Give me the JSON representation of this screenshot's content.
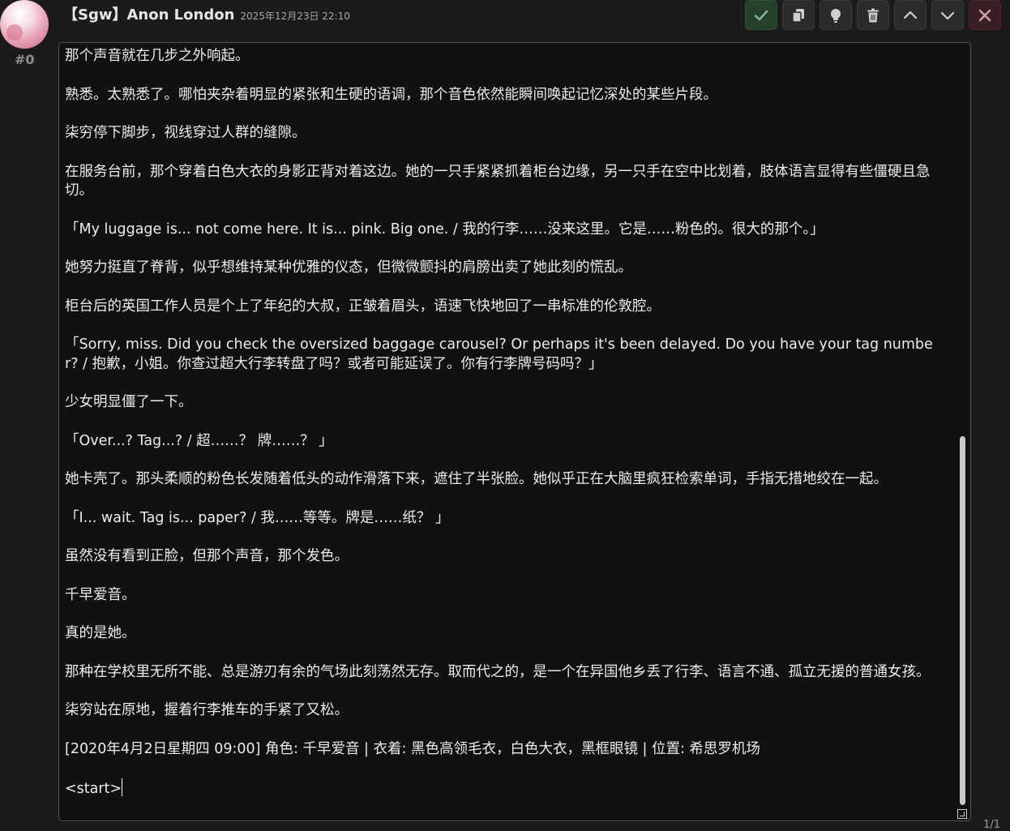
{
  "message": {
    "id": "#0",
    "author": "【Sgw】Anon London",
    "timestamp": "2025年12月23日 22:10",
    "swipe_counter": "1/1"
  },
  "toolbar": {
    "icons": [
      "check-icon",
      "copy-icon",
      "lightbulb-icon",
      "trash-icon",
      "chevron-up-icon",
      "chevron-down-icon",
      "close-icon"
    ],
    "confirm_color": "#26402b",
    "close_color": "#3a1f22"
  },
  "editor": {
    "paragraphs": [
      "那个声音就在几步之外响起。",
      "熟悉。太熟悉了。哪怕夹杂着明显的紧张和生硬的语调，那个音色依然能瞬间唤起记忆深处的某些片段。",
      "柒穷停下脚步，视线穿过人群的缝隙。",
      "在服务台前，那个穿着白色大衣的身影正背对着这边。她的一只手紧紧抓着柜台边缘，另一只手在空中比划着，肢体语言显得有些僵硬且急切。",
      "「My luggage is... not come here. It is... pink. Big one. / 我的行李……没来这里。它是……粉色的。很大的那个。」",
      "她努力挺直了脊背，似乎想维持某种优雅的仪态，但微微颤抖的肩膀出卖了她此刻的慌乱。",
      "柜台后的英国工作人员是个上了年纪的大叔，正皱着眉头，语速飞快地回了一串标准的伦敦腔。",
      "「Sorry, miss. Did you check the oversized baggage carousel? Or perhaps it's been delayed. Do you have your tag number? / 抱歉，小姐。你查过超大行李转盘了吗？或者可能延误了。你有行李牌号码吗？」",
      "少女明显僵了一下。",
      "「Over...? Tag...? / 超……？ 牌……？ 」",
      "她卡壳了。那头柔顺的粉色长发随着低头的动作滑落下来，遮住了半张脸。她似乎正在大脑里疯狂检索单词，手指无措地绞在一起。",
      "「I... wait. Tag is... paper? / 我……等等。牌是……纸？ 」",
      "虽然没有看到正脸，但那个声音，那个发色。",
      "千早爱音。",
      "真的是她。",
      "那种在学校里无所不能、总是游刃有余的气场此刻荡然无存。取而代之的，是一个在异国他乡丢了行李、语言不通、孤立无援的普通女孩。",
      "柒穷站在原地，握着行李推车的手紧了又松。",
      "[2020年4月2日星期四 09:00] 角色: 千早爱音 | 衣着: 黑色高领毛衣，白色大衣，黑框眼镜 | 位置: 希思罗机场",
      "<start>"
    ]
  }
}
